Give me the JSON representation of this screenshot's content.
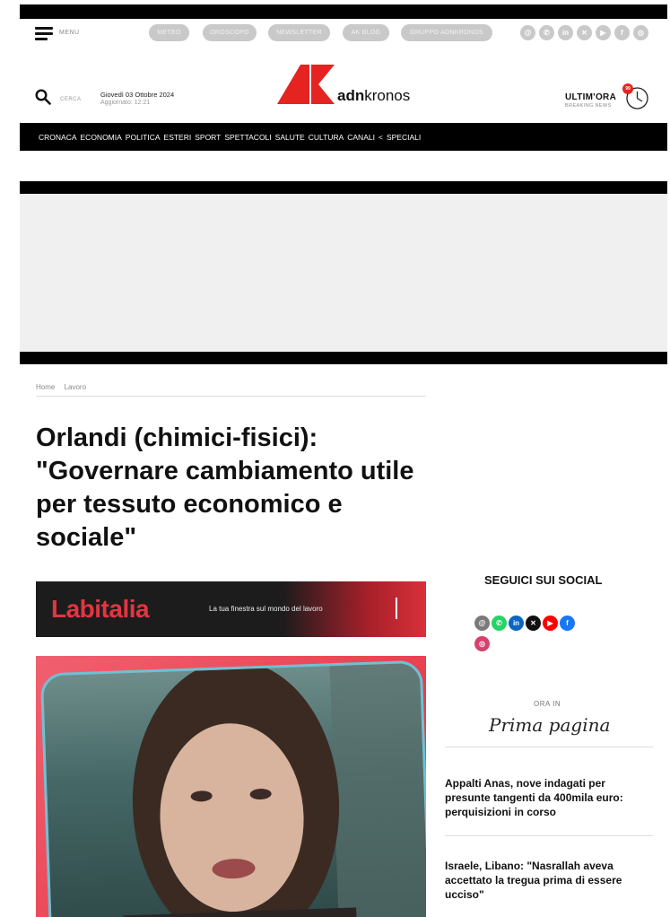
{
  "header": {
    "menu_label": "MENU",
    "top_pills": [
      "METEO",
      "OROSCOPO",
      "NEWSLETTER",
      "AK BLOG",
      "GRUPPO ADNKRONOS"
    ],
    "top_social_icons": [
      "threads-icon",
      "whatsapp-icon",
      "linkedin-icon",
      "x-icon",
      "youtube-icon",
      "facebook-icon",
      "instagram-icon"
    ],
    "search_label": "CERCA",
    "date": "Giovedì 03 Ottobre 2024",
    "updated": "Aggiornato: 12:21",
    "logo": {
      "brand_bold": "adn",
      "brand_rest": "kronos"
    },
    "ultim_ora": "ULTIM'ORA",
    "breaking_news": "BREAKING NEWS",
    "badge_count": "99"
  },
  "nav": {
    "items": [
      "CRONACA",
      "ECONOMIA",
      "POLITICA",
      "ESTERI",
      "SPORT",
      "SPETTACOLI",
      "SALUTE",
      "CULTURA",
      "CANALI",
      "<",
      "SPECIALI"
    ]
  },
  "article": {
    "breadcrumb": [
      "Home",
      "Lavoro"
    ],
    "headline": "Orlandi (chimici-fisici): \"Governare cambiamento utile per tessuto economico e sociale\"",
    "banner": {
      "title": "Labitalia",
      "tagline": "La tua finestra sul mondo del lavoro"
    }
  },
  "sidebar": {
    "social_title": "SEGUICI SUI SOCIAL",
    "social_icons": [
      "threads-icon",
      "whatsapp-icon",
      "linkedin-icon",
      "x-icon",
      "youtube-icon",
      "facebook-icon",
      "instagram-icon"
    ],
    "ora_in": "ORA IN",
    "prima_pagina": "Prima pagina",
    "news": [
      "Appalti Anas, nove indagati per presunte tangenti da 400mila euro: perquisizioni in corso",
      "Israele, Libano: \"Nasrallah aveva accettato la tregua prima di essere ucciso\""
    ]
  },
  "colors": {
    "brand_red": "#e52321",
    "nav_bg": "#000000"
  }
}
